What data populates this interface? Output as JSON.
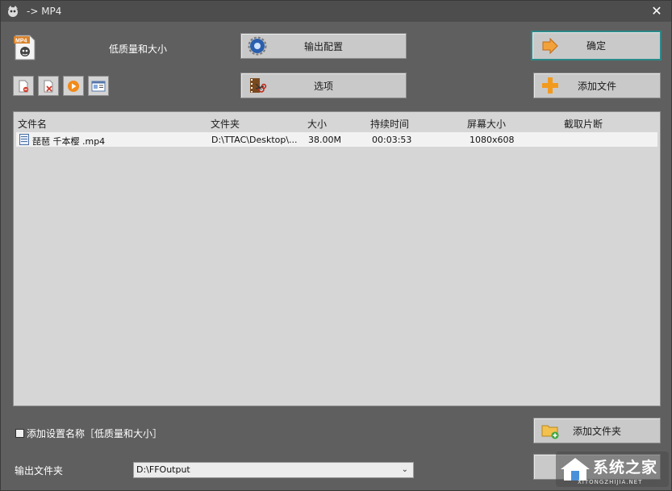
{
  "title": "-> MP4",
  "profile": {
    "label": "低质量和大小",
    "icon": "mp4-profile-icon"
  },
  "buttons": {
    "output_config": "输出配置",
    "options": "选项",
    "ok": "确定",
    "add_file": "添加文件",
    "add_folder": "添加文件夹"
  },
  "toolbar": [
    {
      "name": "remove-file-icon"
    },
    {
      "name": "clear-list-icon"
    },
    {
      "name": "play-icon"
    },
    {
      "name": "media-info-icon"
    }
  ],
  "list": {
    "columns": [
      "文件名",
      "文件夹",
      "大小",
      "持续时间",
      "屏幕大小",
      "截取片断"
    ],
    "rows": [
      {
        "name": "琵琶 千本樱 .mp4",
        "folder": "D:\\TTAC\\Desktop\\...",
        "size": "38.00M",
        "duration": "00:03:53",
        "screen": "1080x608",
        "clip": ""
      }
    ]
  },
  "add_setting_name": {
    "label": "添加设置名称［低质量和大小］",
    "checked": false
  },
  "output_folder": {
    "label": "输出文件夹",
    "value": "D:\\FFOutput"
  },
  "watermark": {
    "text": "系统之家",
    "sub": "XITONGZHIJIA.NET"
  },
  "colors": {
    "ok_border": "#2b8a8a",
    "window_bg": "#5f5f5f",
    "list_bg": "#d6d6d6"
  }
}
